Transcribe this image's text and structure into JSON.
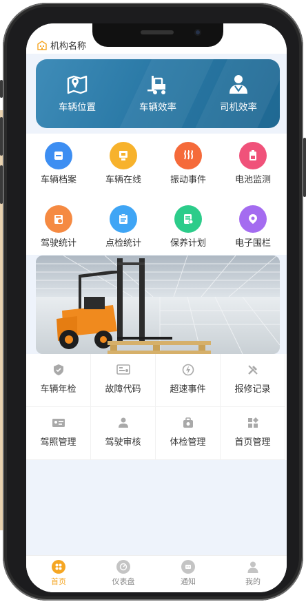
{
  "header": {
    "org_name": "机构名称"
  },
  "banner": {
    "items": [
      {
        "label": "车辆位置",
        "icon": "map-pin-icon"
      },
      {
        "label": "车辆效率",
        "icon": "forklift-icon"
      },
      {
        "label": "司机效率",
        "icon": "driver-icon"
      }
    ]
  },
  "grid1": {
    "items": [
      {
        "label": "车辆档案",
        "icon": "archive-icon",
        "color": "#3d8ef2"
      },
      {
        "label": "车辆在线",
        "icon": "online-icon",
        "color": "#f7b22c"
      },
      {
        "label": "振动事件",
        "icon": "vibration-icon",
        "color": "#f56a3a"
      },
      {
        "label": "电池监测",
        "icon": "battery-icon",
        "color": "#f0527a"
      },
      {
        "label": "驾驶统计",
        "icon": "driving-stats-icon",
        "color": "#f58a42"
      },
      {
        "label": "点检统计",
        "icon": "inspection-icon",
        "color": "#3fa5f5"
      },
      {
        "label": "保养计划",
        "icon": "maintenance-icon",
        "color": "#2ccc8a"
      },
      {
        "label": "电子围栏",
        "icon": "geofence-icon",
        "color": "#a46cf0"
      }
    ]
  },
  "grid2": {
    "items": [
      {
        "label": "车辆年检",
        "icon": "shield-icon"
      },
      {
        "label": "故障代码",
        "icon": "fault-code-icon"
      },
      {
        "label": "超速事件",
        "icon": "speed-icon"
      },
      {
        "label": "报修记录",
        "icon": "repair-icon"
      },
      {
        "label": "驾照管理",
        "icon": "license-icon"
      },
      {
        "label": "驾驶审核",
        "icon": "user-review-icon"
      },
      {
        "label": "体检管理",
        "icon": "checkup-icon"
      },
      {
        "label": "首页管理",
        "icon": "home-manage-icon"
      }
    ]
  },
  "tabbar": {
    "items": [
      {
        "label": "首页",
        "icon": "home-icon",
        "active": true
      },
      {
        "label": "仪表盘",
        "icon": "dashboard-icon",
        "active": false
      },
      {
        "label": "通知",
        "icon": "notice-icon",
        "active": false
      },
      {
        "label": "我的",
        "icon": "profile-icon",
        "active": false
      }
    ]
  },
  "colors": {
    "accent": "#f5a623",
    "banner": "#2a79a6",
    "icon_gray": "#9a9a9a"
  }
}
